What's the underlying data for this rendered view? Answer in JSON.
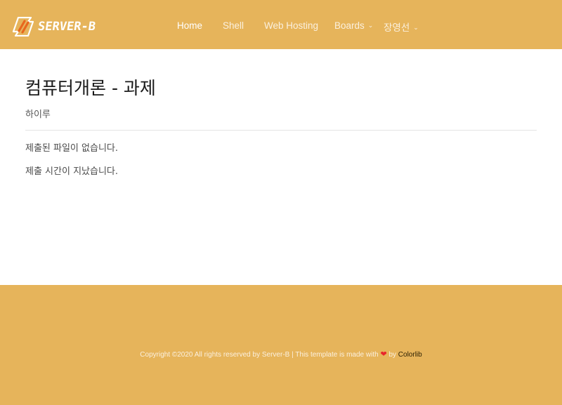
{
  "header": {
    "logo_text": "SERVER-B",
    "nav": [
      {
        "label": "Home",
        "active": true,
        "has_dropdown": false
      },
      {
        "label": "Shell",
        "active": false,
        "has_dropdown": false
      },
      {
        "label": "Web Hosting",
        "active": false,
        "has_dropdown": false
      },
      {
        "label": "Boards",
        "active": false,
        "has_dropdown": true
      },
      {
        "label": "장영선",
        "active": false,
        "has_dropdown": true
      }
    ]
  },
  "main": {
    "title": "컴퓨터개론 - 과제",
    "author": "하이루",
    "messages": [
      "제출된 파일이 없습니다.",
      "제출 시간이 지났습니다."
    ]
  },
  "footer": {
    "copyright": "Copyright ©2020 All rights reserved by Server-B | This template is made with",
    "heart_icon": "heart-icon",
    "by": "by",
    "link_label": "Colorlib"
  },
  "colors": {
    "accent": "#e6b45b",
    "heart": "#e8242b"
  }
}
